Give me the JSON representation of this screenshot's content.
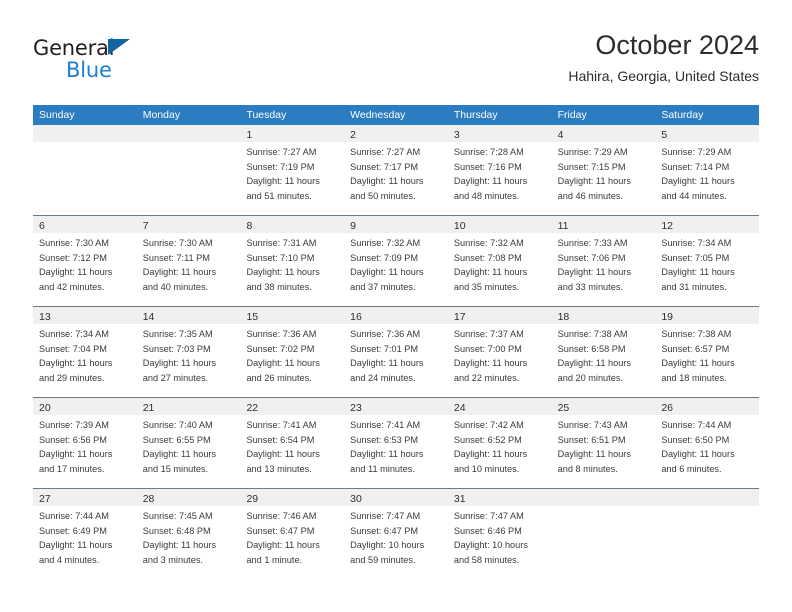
{
  "brand": {
    "name_part1": "General",
    "name_part2": "Blue"
  },
  "header": {
    "title": "October 2024",
    "subtitle": "Hahira, Georgia, United States"
  },
  "colors": {
    "header_blue": "#2b7cc0",
    "brand_blue": "#1c7fd4",
    "daynum_band": "#f0f0f0",
    "row_divider": "#6d7b86"
  },
  "day_headers": [
    "Sunday",
    "Monday",
    "Tuesday",
    "Wednesday",
    "Thursday",
    "Friday",
    "Saturday"
  ],
  "weeks": [
    [
      {
        "day": "",
        "sunrise": "",
        "sunset": "",
        "daylight1": "",
        "daylight2": ""
      },
      {
        "day": "",
        "sunrise": "",
        "sunset": "",
        "daylight1": "",
        "daylight2": ""
      },
      {
        "day": "1",
        "sunrise": "Sunrise: 7:27 AM",
        "sunset": "Sunset: 7:19 PM",
        "daylight1": "Daylight: 11 hours",
        "daylight2": "and 51 minutes."
      },
      {
        "day": "2",
        "sunrise": "Sunrise: 7:27 AM",
        "sunset": "Sunset: 7:17 PM",
        "daylight1": "Daylight: 11 hours",
        "daylight2": "and 50 minutes."
      },
      {
        "day": "3",
        "sunrise": "Sunrise: 7:28 AM",
        "sunset": "Sunset: 7:16 PM",
        "daylight1": "Daylight: 11 hours",
        "daylight2": "and 48 minutes."
      },
      {
        "day": "4",
        "sunrise": "Sunrise: 7:29 AM",
        "sunset": "Sunset: 7:15 PM",
        "daylight1": "Daylight: 11 hours",
        "daylight2": "and 46 minutes."
      },
      {
        "day": "5",
        "sunrise": "Sunrise: 7:29 AM",
        "sunset": "Sunset: 7:14 PM",
        "daylight1": "Daylight: 11 hours",
        "daylight2": "and 44 minutes."
      }
    ],
    [
      {
        "day": "6",
        "sunrise": "Sunrise: 7:30 AM",
        "sunset": "Sunset: 7:12 PM",
        "daylight1": "Daylight: 11 hours",
        "daylight2": "and 42 minutes."
      },
      {
        "day": "7",
        "sunrise": "Sunrise: 7:30 AM",
        "sunset": "Sunset: 7:11 PM",
        "daylight1": "Daylight: 11 hours",
        "daylight2": "and 40 minutes."
      },
      {
        "day": "8",
        "sunrise": "Sunrise: 7:31 AM",
        "sunset": "Sunset: 7:10 PM",
        "daylight1": "Daylight: 11 hours",
        "daylight2": "and 38 minutes."
      },
      {
        "day": "9",
        "sunrise": "Sunrise: 7:32 AM",
        "sunset": "Sunset: 7:09 PM",
        "daylight1": "Daylight: 11 hours",
        "daylight2": "and 37 minutes."
      },
      {
        "day": "10",
        "sunrise": "Sunrise: 7:32 AM",
        "sunset": "Sunset: 7:08 PM",
        "daylight1": "Daylight: 11 hours",
        "daylight2": "and 35 minutes."
      },
      {
        "day": "11",
        "sunrise": "Sunrise: 7:33 AM",
        "sunset": "Sunset: 7:06 PM",
        "daylight1": "Daylight: 11 hours",
        "daylight2": "and 33 minutes."
      },
      {
        "day": "12",
        "sunrise": "Sunrise: 7:34 AM",
        "sunset": "Sunset: 7:05 PM",
        "daylight1": "Daylight: 11 hours",
        "daylight2": "and 31 minutes."
      }
    ],
    [
      {
        "day": "13",
        "sunrise": "Sunrise: 7:34 AM",
        "sunset": "Sunset: 7:04 PM",
        "daylight1": "Daylight: 11 hours",
        "daylight2": "and 29 minutes."
      },
      {
        "day": "14",
        "sunrise": "Sunrise: 7:35 AM",
        "sunset": "Sunset: 7:03 PM",
        "daylight1": "Daylight: 11 hours",
        "daylight2": "and 27 minutes."
      },
      {
        "day": "15",
        "sunrise": "Sunrise: 7:36 AM",
        "sunset": "Sunset: 7:02 PM",
        "daylight1": "Daylight: 11 hours",
        "daylight2": "and 26 minutes."
      },
      {
        "day": "16",
        "sunrise": "Sunrise: 7:36 AM",
        "sunset": "Sunset: 7:01 PM",
        "daylight1": "Daylight: 11 hours",
        "daylight2": "and 24 minutes."
      },
      {
        "day": "17",
        "sunrise": "Sunrise: 7:37 AM",
        "sunset": "Sunset: 7:00 PM",
        "daylight1": "Daylight: 11 hours",
        "daylight2": "and 22 minutes."
      },
      {
        "day": "18",
        "sunrise": "Sunrise: 7:38 AM",
        "sunset": "Sunset: 6:58 PM",
        "daylight1": "Daylight: 11 hours",
        "daylight2": "and 20 minutes."
      },
      {
        "day": "19",
        "sunrise": "Sunrise: 7:38 AM",
        "sunset": "Sunset: 6:57 PM",
        "daylight1": "Daylight: 11 hours",
        "daylight2": "and 18 minutes."
      }
    ],
    [
      {
        "day": "20",
        "sunrise": "Sunrise: 7:39 AM",
        "sunset": "Sunset: 6:56 PM",
        "daylight1": "Daylight: 11 hours",
        "daylight2": "and 17 minutes."
      },
      {
        "day": "21",
        "sunrise": "Sunrise: 7:40 AM",
        "sunset": "Sunset: 6:55 PM",
        "daylight1": "Daylight: 11 hours",
        "daylight2": "and 15 minutes."
      },
      {
        "day": "22",
        "sunrise": "Sunrise: 7:41 AM",
        "sunset": "Sunset: 6:54 PM",
        "daylight1": "Daylight: 11 hours",
        "daylight2": "and 13 minutes."
      },
      {
        "day": "23",
        "sunrise": "Sunrise: 7:41 AM",
        "sunset": "Sunset: 6:53 PM",
        "daylight1": "Daylight: 11 hours",
        "daylight2": "and 11 minutes."
      },
      {
        "day": "24",
        "sunrise": "Sunrise: 7:42 AM",
        "sunset": "Sunset: 6:52 PM",
        "daylight1": "Daylight: 11 hours",
        "daylight2": "and 10 minutes."
      },
      {
        "day": "25",
        "sunrise": "Sunrise: 7:43 AM",
        "sunset": "Sunset: 6:51 PM",
        "daylight1": "Daylight: 11 hours",
        "daylight2": "and 8 minutes."
      },
      {
        "day": "26",
        "sunrise": "Sunrise: 7:44 AM",
        "sunset": "Sunset: 6:50 PM",
        "daylight1": "Daylight: 11 hours",
        "daylight2": "and 6 minutes."
      }
    ],
    [
      {
        "day": "27",
        "sunrise": "Sunrise: 7:44 AM",
        "sunset": "Sunset: 6:49 PM",
        "daylight1": "Daylight: 11 hours",
        "daylight2": "and 4 minutes."
      },
      {
        "day": "28",
        "sunrise": "Sunrise: 7:45 AM",
        "sunset": "Sunset: 6:48 PM",
        "daylight1": "Daylight: 11 hours",
        "daylight2": "and 3 minutes."
      },
      {
        "day": "29",
        "sunrise": "Sunrise: 7:46 AM",
        "sunset": "Sunset: 6:47 PM",
        "daylight1": "Daylight: 11 hours",
        "daylight2": "and 1 minute."
      },
      {
        "day": "30",
        "sunrise": "Sunrise: 7:47 AM",
        "sunset": "Sunset: 6:47 PM",
        "daylight1": "Daylight: 10 hours",
        "daylight2": "and 59 minutes."
      },
      {
        "day": "31",
        "sunrise": "Sunrise: 7:47 AM",
        "sunset": "Sunset: 6:46 PM",
        "daylight1": "Daylight: 10 hours",
        "daylight2": "and 58 minutes."
      },
      {
        "day": "",
        "sunrise": "",
        "sunset": "",
        "daylight1": "",
        "daylight2": ""
      },
      {
        "day": "",
        "sunrise": "",
        "sunset": "",
        "daylight1": "",
        "daylight2": ""
      }
    ]
  ]
}
